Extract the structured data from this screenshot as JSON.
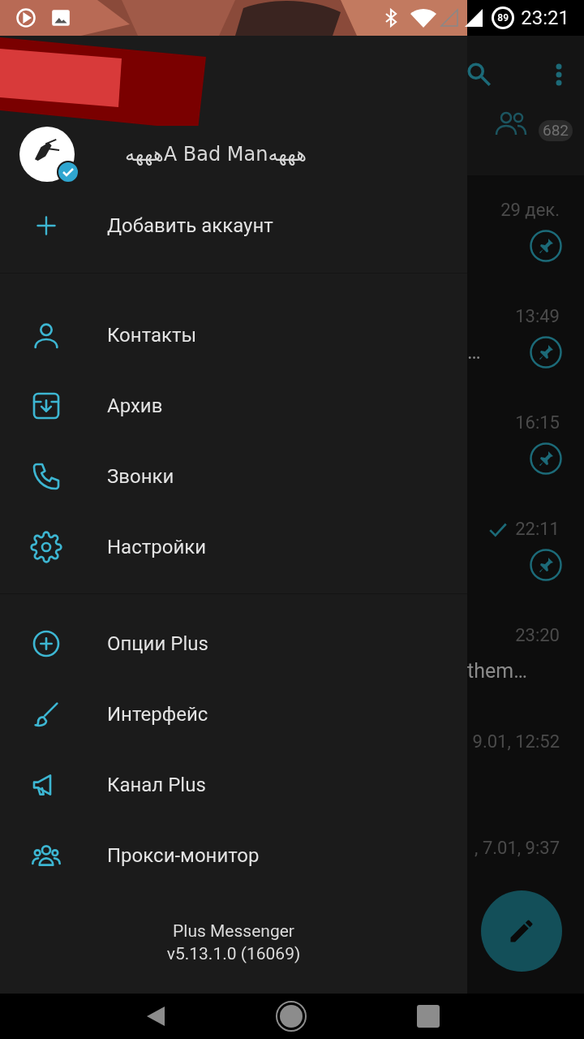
{
  "status_bar": {
    "battery": "89",
    "time": "23:21"
  },
  "drawer": {
    "account": {
      "name": "ههههA Bad Manهههه",
      "verified": true
    },
    "add_account": "Добавить аккаунт",
    "groups": [
      [
        {
          "label": "Контакты"
        },
        {
          "label": "Архив"
        },
        {
          "label": "Звонки"
        },
        {
          "label": "Настройки"
        }
      ],
      [
        {
          "label": "Опции Plus"
        },
        {
          "label": "Интерфейс"
        },
        {
          "label": "Канал Plus"
        },
        {
          "label": "Прокси-монитор"
        }
      ]
    ],
    "footer": [
      "Plus Messenger",
      "v5.13.1.0 (16069)"
    ]
  },
  "chat_list": {
    "badge": "682",
    "rows": [
      {
        "time": "29 дек.",
        "read": false,
        "pinned": true
      },
      {
        "time": "13:49",
        "preview": "…",
        "read": false,
        "pinned": true
      },
      {
        "time": "16:15",
        "read": false,
        "pinned": true
      },
      {
        "time": "22:11",
        "read": true,
        "pinned": true
      },
      {
        "time": "23:20",
        "preview": "them…",
        "read": false,
        "pinned": false
      },
      {
        "time": "9.01, 12:52",
        "read": false,
        "pinned": false
      },
      {
        "time": ", 7.01, 9:37",
        "read": false,
        "pinned": false
      }
    ]
  }
}
